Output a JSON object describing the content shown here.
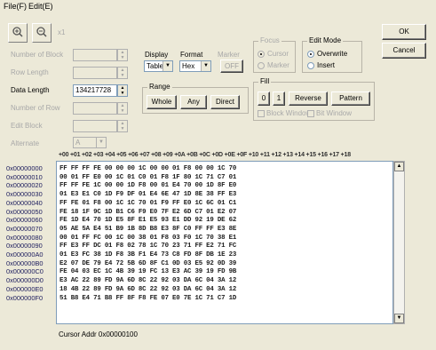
{
  "menu": {
    "file": "File(F)",
    "edit": "Edit(E)"
  },
  "toolbar": {
    "x1": "x1"
  },
  "left": {
    "number_of_block": "Number of Block",
    "row_length": "Row Length",
    "data_length": "Data Length",
    "data_length_value": "134217728",
    "number_of_row": "Number of Row",
    "edit_block": "Edit Block",
    "alternate": "Alternate",
    "alternate_value": "A"
  },
  "display": {
    "label": "Display",
    "value": "Table"
  },
  "format": {
    "label": "Format",
    "value": "Hex"
  },
  "marker": {
    "label": "Marker",
    "button": "OFF"
  },
  "range": {
    "label": "Range",
    "whole": "Whole",
    "any": "Any",
    "direct": "Direct"
  },
  "focus": {
    "label": "Focus",
    "cursor": "Cursor",
    "marker": "Marker"
  },
  "edit_mode": {
    "label": "Edit Mode",
    "overwrite": "Overwrite",
    "insert": "Insert"
  },
  "fill": {
    "label": "Fill",
    "zero": "0",
    "one": "1",
    "reverse": "Reverse",
    "pattern": "Pattern",
    "block_window": "Block Window",
    "bit_window": "Bit Window"
  },
  "dialog": {
    "ok": "OK",
    "cancel": "Cancel"
  },
  "hex_header": "+00 +01 +02 +03 +04 +05 +06 +07 +08 +09 +0A +0B +0C +0D +0E +0F +10 +11 +12 +13 +14 +15 +16 +17 +18",
  "addresses": [
    "0x00000000",
    "0x00000010",
    "0x00000020",
    "0x00000030",
    "0x00000040",
    "0x00000050",
    "0x00000060",
    "0x00000070",
    "0x00000080",
    "0x00000090",
    "0x000000A0",
    "0x000000B0",
    "0x000000C0",
    "0x000000D0",
    "0x000000E0",
    "0x000000F0"
  ],
  "hex_rows": [
    "FF FF FF FE 00 00 00 1C 00 00 01 F8 00 00 1C 70",
    "00 01 FF E0 00 1C 01 C0 01 F8 1F 80 1C 71 C7 01",
    "FF FF FE 1C 00 00 1D F8 00 01 E4 70 00 1D 8F E0",
    "01 E3 E1 C0 1D F9 DF 01 E4 6E 47 1D 8E 38 FF E3",
    "FF FE 01 F8 00 1C 1C 70 01 F9 FF E0 1C 6C 01 C1",
    "FE 18 1F 9C 1D B1 C6 F9 E0 7F E2 6D C7 01 E2 07",
    "FE 1D E4 70 1D E5 8F E1 E5 93 E1 DD 92 19 DE 62",
    "05 AE 5A E4 51 B9 1B 8D B8 E3 8F C0 FF FF E3 8E",
    "00 01 FF FC 00 1C 00 38 01 F8 03 F0 1C 70 38 E1",
    "FF E3 FF DC 01 F8 02 78 1C 70 23 71 FF E2 71 FC",
    "01 E3 FC 38 1D F8 3B F1 E4 73 C8 FD 8F DB 1E 23",
    "E2 07 DE 79 E4 72 5B 6D 8F C1 0D 03 E5 92 0D 39",
    "FE 04 03 EC 1C 4B 39 19 FC 13 E3 AC 39 19 FD 9B",
    "E3 AC 22 89 FD 9A 6D 8C 22 92 03 DA 6C 04 3A 12",
    "18 4B 22 89 FD 9A 6D 8C 22 92 03 DA 6C 04 3A 12",
    "51 B8 E4 71 B8 FF 8F F8 FE 07 E0 7E 1C 71 C7 1D"
  ],
  "cursor_addr": "Cursor Addr  0x00000100"
}
